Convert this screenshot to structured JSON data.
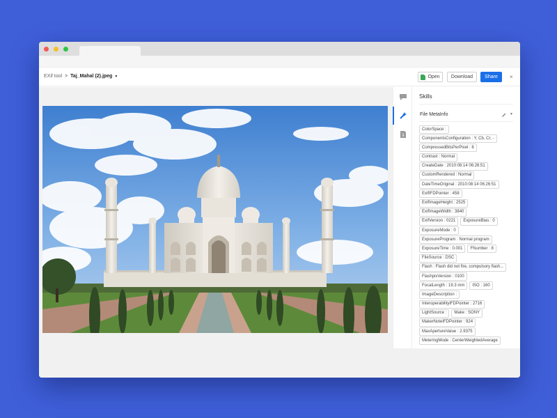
{
  "breadcrumb": {
    "root": "EXif tool",
    "separator": ">",
    "file": "Taj_Mahal (2).jpeg"
  },
  "toolbar": {
    "open_label": "Open",
    "download_label": "Download",
    "share_label": "Share",
    "close_label": "×"
  },
  "colors": {
    "background": "#3f5fd9",
    "accent": "#1a6fe8",
    "open_icon": "#3aa757"
  },
  "rail_icons": [
    "chat-icon",
    "magic-wand-icon",
    "document-info-icon"
  ],
  "sidebar": {
    "title": "Skills",
    "section_title": "File MetaInfo",
    "metadata_rows": [
      [
        "ColorSpace :"
      ],
      [
        "ComponentsConfiguration : Y, Cb, Cr, -"
      ],
      [
        "CompressedBitsPerPixel : 8"
      ],
      [
        "Contrast : Normal"
      ],
      [
        "CreateDate : 2010:08:14 06:26:51"
      ],
      [
        "CustomRendered : Normal"
      ],
      [
        "DateTimeOriginal : 2010:08:14 06:26:51"
      ],
      [
        "ExifIFDPointer : 458"
      ],
      [
        "ExifImageHeight : 2525"
      ],
      [
        "ExifImageWidth : 3840"
      ],
      [
        "ExifVersion : 0221",
        "ExposureBias : 0"
      ],
      [
        "ExposureMode : 0"
      ],
      [
        "ExposureProgram : Normal program"
      ],
      [
        "ExposureTime : 0.001",
        "FNumber : 8"
      ],
      [
        "FileSource : DSC"
      ],
      [
        "Flash : Flash did not fire, compulsory flash..."
      ],
      [
        "FlashpixVersion : 0100"
      ],
      [
        "FocalLength : 19.3 mm",
        "ISO : 160"
      ],
      [
        "ImageDescription :"
      ],
      [
        "InteroperabilityIFDPointer : 2716"
      ],
      [
        "LightSource :",
        "Make : SONY"
      ],
      [
        "MakerNoteIFDPointer : 924"
      ],
      [
        "MaxApertureValue : 2.9375"
      ],
      [
        "MeteringMode : CenterWeightedAverage"
      ]
    ]
  }
}
